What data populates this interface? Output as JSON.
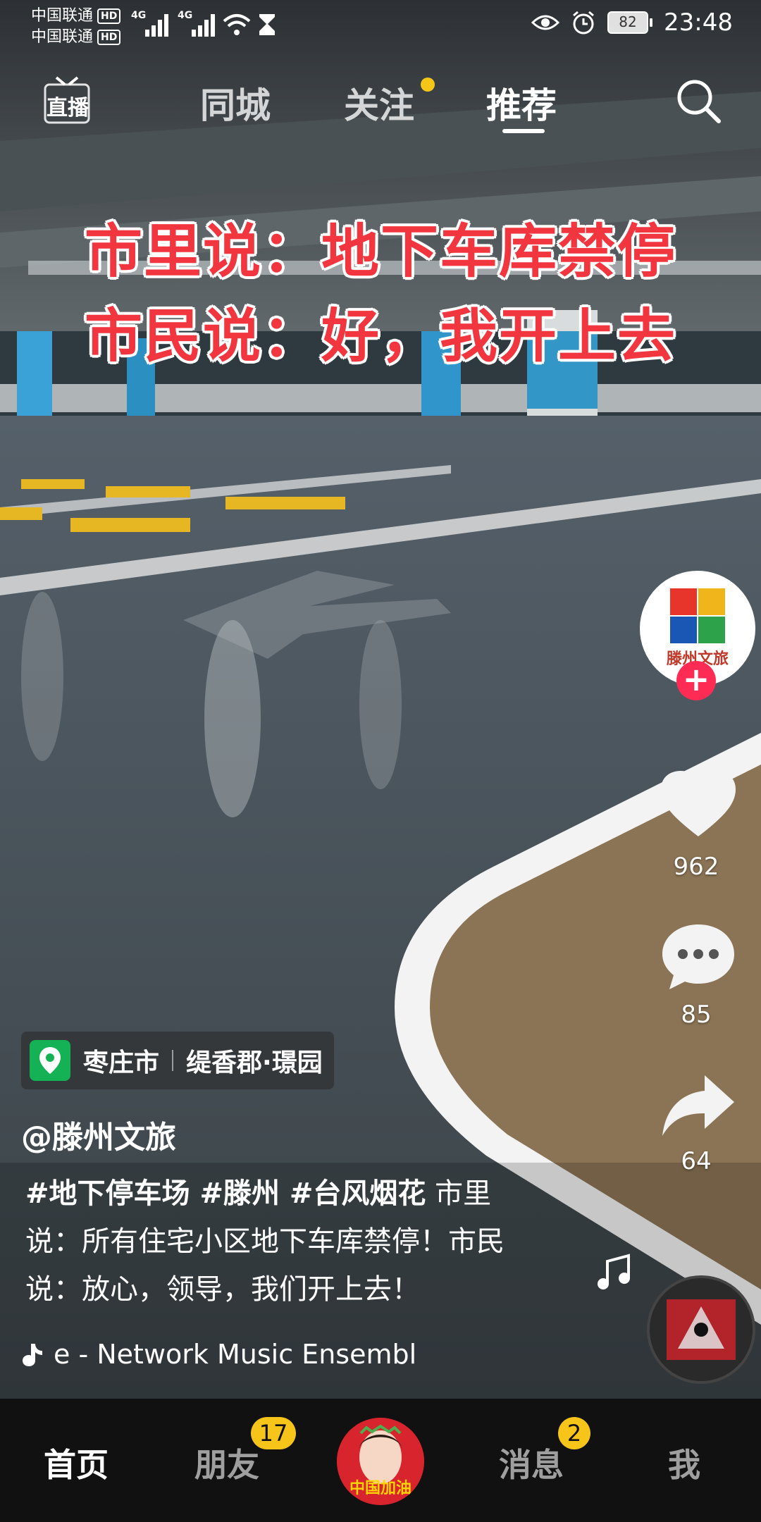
{
  "status_bar": {
    "carrier_1": "中国联通",
    "carrier_2": "中国联通",
    "hd": "HD",
    "net_1": "4G",
    "net_2": "4G",
    "battery": "82",
    "time": "23:48"
  },
  "top_nav": {
    "live_label": "直播",
    "tabs": [
      "同城",
      "关注",
      "推荐"
    ],
    "active_tab": "推荐"
  },
  "overlay": {
    "line1": "市里说：地下车库禁停",
    "line2": "市民说：好，我开上去"
  },
  "creator": {
    "avatar_text": "滕州文旅",
    "handle": "@滕州文旅"
  },
  "stats": {
    "likes": "962",
    "comments": "85",
    "shares": "64"
  },
  "location": {
    "city": "枣庄市",
    "place": "缇香郡·璟园"
  },
  "description": {
    "tags": "#地下停车场 #滕州 #台风烟花",
    "text": "市里说：所有住宅小区地下车库禁停！市民说：放心，领导，我们开上去！"
  },
  "music": {
    "text": "e - Network Music Ensembl"
  },
  "bottom_nav": {
    "home": "首页",
    "friends": "朋友",
    "friends_badge": "17",
    "center_text": "中国加油",
    "messages": "消息",
    "messages_badge": "2",
    "me": "我"
  },
  "colors": {
    "accent_red": "#fe2c55",
    "badge_yellow": "#f7c51a",
    "caption_red": "#f2363f"
  }
}
